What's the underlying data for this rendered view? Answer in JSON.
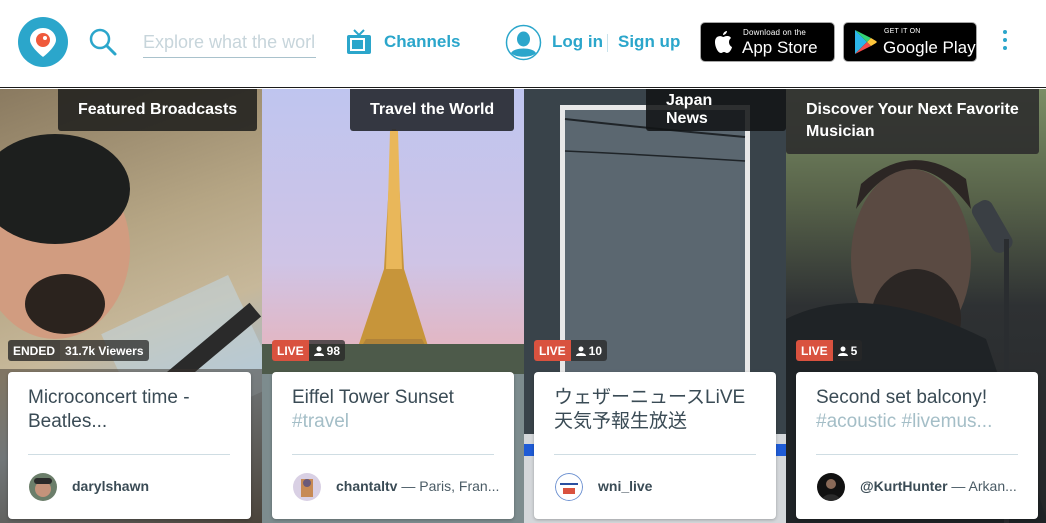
{
  "header": {
    "logo": "periscope-logo",
    "search": {
      "placeholder": "Explore what the world is watching",
      "value": ""
    },
    "channels_label": "Channels",
    "login_label": "Log in",
    "signup_label": "Sign up",
    "app_store": {
      "small": "Download on the",
      "big": "App Store"
    },
    "google_play": {
      "small": "GET IT ON",
      "big": "Google Play"
    },
    "brand_color": "#2ba6cb"
  },
  "tiles": [
    {
      "channel": "Featured Broadcasts",
      "state": "ENDED",
      "count": "31.7k Viewers",
      "title": "Microconcert time - Beatles...",
      "tags": "",
      "username": "darylshawn",
      "location": ""
    },
    {
      "channel": "Travel the World",
      "state": "LIVE",
      "count": "98",
      "title": "Eiffel Tower Sunset ",
      "tags": "#travel",
      "username": "chantaltv",
      "location": " — Paris, Fran..."
    },
    {
      "channel": "Japan News",
      "state": "LIVE",
      "count": "10",
      "title": "ウェザーニュースLiVE 天気予報生放送",
      "tags": "",
      "username": "wni_live",
      "location": ""
    },
    {
      "channel": "Discover Your Next Favorite Musician",
      "state": "LIVE",
      "count": "5",
      "title": "Second set balcony! ",
      "tags": "#acoustic #livemus...",
      "username": "@KurtHunter",
      "location": " — Arkan..."
    }
  ],
  "colors": {
    "live": "#d9523f",
    "text": "#3a4b55",
    "tag": "#a4bec7"
  }
}
